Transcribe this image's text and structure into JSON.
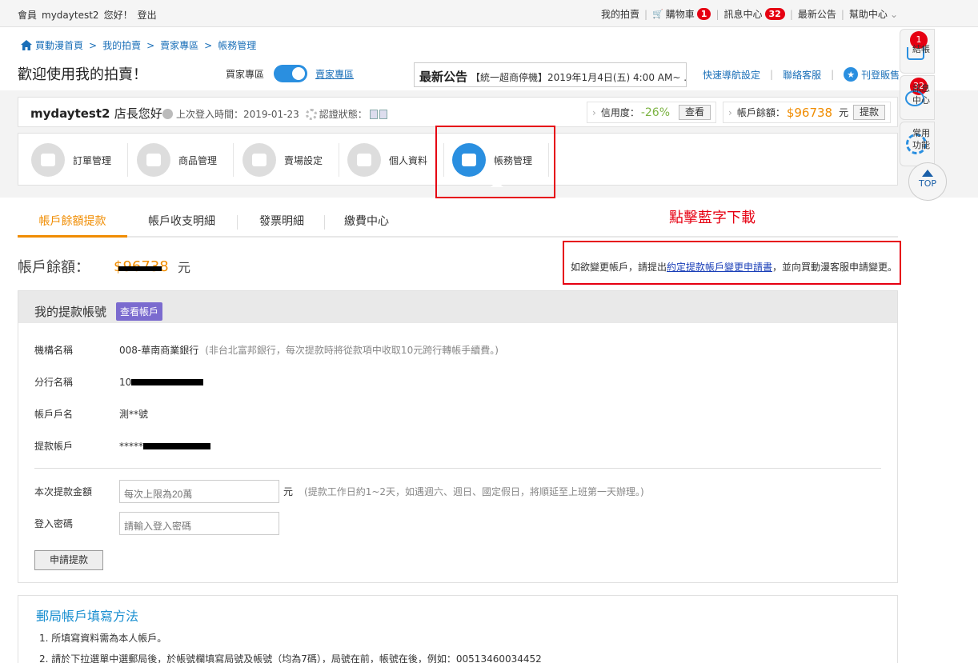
{
  "topbar": {
    "member_prefix": "會員",
    "username": "mydaytest2",
    "greeting": "您好！",
    "logout": "登出",
    "my_auction": "我的拍賣",
    "cart": "購物車",
    "cart_count": "1",
    "messages": "訊息中心",
    "messages_count": "32",
    "announcements": "最新公告",
    "help": "幫助中心"
  },
  "breadcrumb": [
    "買動漫首頁",
    "我的拍賣",
    "賣家專區",
    "帳務管理"
  ],
  "welcome": "歡迎使用我的拍賣！",
  "toggle": {
    "left": "買家專區",
    "right": "賣家專區"
  },
  "news": {
    "title": "最新公告",
    "text": "【統一超商停機】2019年1月4日(五) 4:00 AM~ ..."
  },
  "quick_links": [
    "快速導航設定",
    "聯絡客服",
    "刊登販售"
  ],
  "store": {
    "name": "mydaytest2",
    "suffix": "店長您好",
    "last_login": "上次登入時間：2019-01-23",
    "auth": "認證狀態：",
    "credit_label": "信用度：",
    "credit_value": "-26%",
    "check": "查看",
    "balance_label": "帳戶餘額：",
    "balance_value": "$96738",
    "balance_unit": "元",
    "withdraw": "提款"
  },
  "nav": [
    "訂單管理",
    "商品管理",
    "賣場設定",
    "個人資料",
    "帳務管理"
  ],
  "float": {
    "checkout": "結帳",
    "checkout_count": "1",
    "msg_line1": "訊息",
    "msg_line2": "中心",
    "msg_count": "32",
    "common_line1": "常用",
    "common_line2": "功能",
    "top": "TOP"
  },
  "tabs": [
    "帳戶餘額提款",
    "帳戶收支明細",
    "發票明細",
    "繳費中心"
  ],
  "annotation": "點擊藍字下載",
  "balance": {
    "label": "帳戶餘額：",
    "value": "$96738",
    "unit": "元"
  },
  "change_note": {
    "before": "如欲變更帳戶，請提出",
    "link": "約定提款帳戶變更申請書",
    "after": "，並向買動漫客服申請變更。"
  },
  "panel": {
    "title": "我的提款帳號",
    "view_btn": "查看帳戶",
    "rows": [
      {
        "k": "機構名稱",
        "v": "008-華南商業銀行",
        "note": "(非台北富邦銀行，每次提款時將從款項中收取10元跨行轉帳手續費。)"
      },
      {
        "k": "分行名稱",
        "v": "10"
      },
      {
        "k": "帳戶戶名",
        "v": "測**號"
      },
      {
        "k": "提款帳戶",
        "v": "*****"
      }
    ],
    "amount_label": "本次提款金額",
    "amount_placeholder": "每次上限為20萬",
    "amount_unit": "元",
    "amount_note": "(提款工作日約1~2天，如遇週六、週日、國定假日，將順延至上班第一天辦理。)",
    "password_label": "登入密碼",
    "password_placeholder": "請輸入登入密碼",
    "apply": "申請提款"
  },
  "post": {
    "title": "郵局帳戶填寫方法",
    "items": [
      "1. 所填寫資料需為本人帳戶。",
      "2. 請於下拉選單中選郵局後，於帳號欄填寫局號及帳號（均為7碼），局號在前，帳號在後，例如：00513460034452"
    ]
  },
  "colors": {
    "accent": "#2a8fe0",
    "orange": "#f08c00",
    "red": "#e60012",
    "link": "#1a6fb8"
  }
}
